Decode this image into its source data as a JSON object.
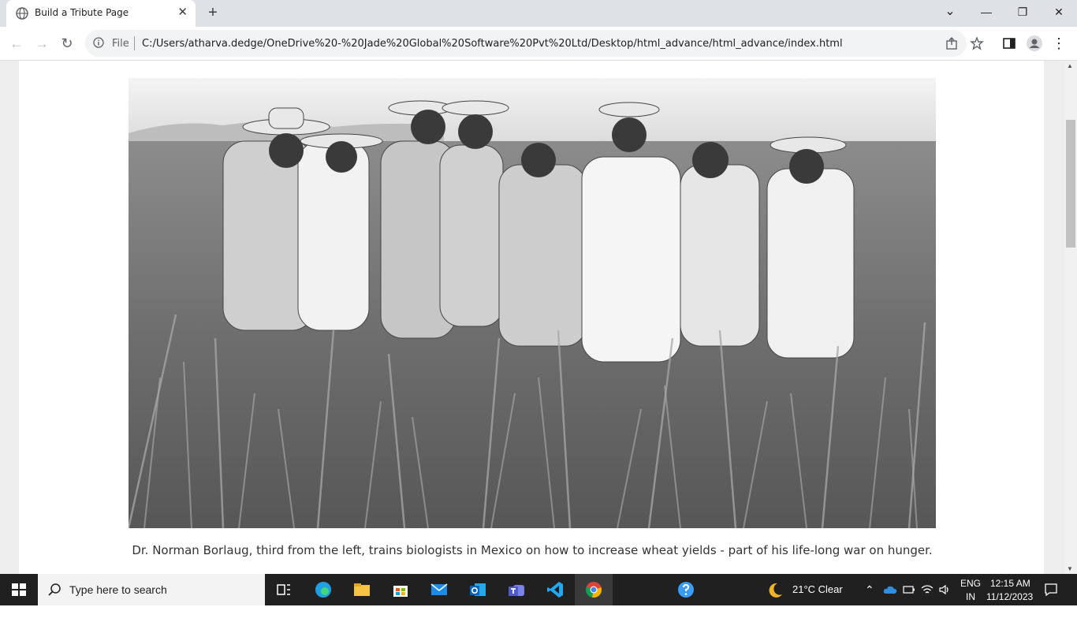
{
  "browser": {
    "tab_title": "Build a Tribute Page",
    "tab_close": "✕",
    "new_tab": "+",
    "back": "←",
    "forward": "→",
    "reload": "↻",
    "file_label": "File",
    "url": "C:/Users/atharva.dedge/OneDrive%20-%20Jade%20Global%20Software%20Pvt%20Ltd/Desktop/html_advance/html_advance/index.html",
    "minimize": "—",
    "restore": "❐",
    "close": "✕",
    "dropdown": "⌄",
    "menu": "⋮"
  },
  "page": {
    "caption": "Dr. Norman Borlaug, third from the left, trains biologists in Mexico on how to increase wheat yields - part of his life-long war on hunger."
  },
  "taskbar": {
    "search_placeholder": "Type here to search",
    "weather": "21°C  Clear",
    "language_top": "ENG",
    "language_bottom": "IN",
    "time": "12:15 AM",
    "date": "11/12/2023",
    "scroll_up": "▲",
    "scroll_down": "▼"
  },
  "icons": [
    "globe-icon",
    "close-icon",
    "plus-icon",
    "back-icon",
    "forward-icon",
    "reload-icon",
    "info-icon",
    "share-icon",
    "star-icon",
    "sidepanel-icon",
    "profile-icon",
    "menu-icon",
    "windows-icon",
    "search-icon",
    "taskview-icon",
    "edge-icon",
    "explorer-icon",
    "store-icon",
    "mail-icon",
    "outlook-icon",
    "teams-icon",
    "vscode-icon",
    "chrome-icon",
    "help-icon",
    "moon-icon",
    "chevron-up-icon",
    "onedrive-icon",
    "battery-icon",
    "wifi-icon",
    "volume-icon",
    "notification-icon"
  ]
}
